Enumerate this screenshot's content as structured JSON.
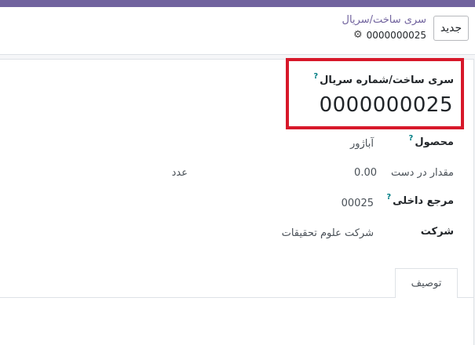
{
  "header": {
    "new_button": "جدید",
    "breadcrumb": "سری ساخت/سریال",
    "record_name": "0000000025",
    "gear_icon": "gear-icon"
  },
  "form": {
    "title_label": "سری ساخت/شماره سریال",
    "help_mark": "?",
    "serial_value": "0000000025",
    "fields": {
      "product_label": "محصول",
      "product_value": "آباژور",
      "quantity_label": "مقدار در دست",
      "quantity_value": "0.00",
      "quantity_unit": "عدد",
      "internal_ref_label": "مرجع داخلی",
      "internal_ref_value": "00025",
      "company_label": "شرکت",
      "company_value": "شرکت علوم تحقیقات"
    },
    "tabs": [
      "توصیف"
    ]
  },
  "colors": {
    "brand": "#71639e",
    "highlight": "#d7182a",
    "help": "#017e84"
  }
}
